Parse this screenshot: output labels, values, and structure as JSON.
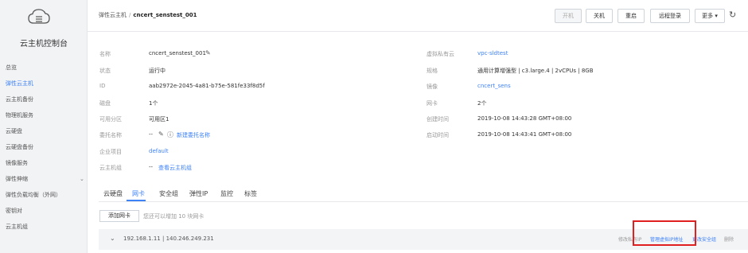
{
  "sidebar": {
    "title": "云主机控制台",
    "items": [
      {
        "label": "总览"
      },
      {
        "label": "弹性云主机"
      },
      {
        "label": "云主机备份"
      },
      {
        "label": "物理机服务"
      },
      {
        "label": "云硬盘"
      },
      {
        "label": "云硬盘备份"
      },
      {
        "label": "镜像服务"
      },
      {
        "label": "弹性伸缩"
      },
      {
        "label": "弹性负载均衡（外网）"
      },
      {
        "label": "密钥对"
      },
      {
        "label": "云主机组"
      }
    ],
    "active_index": 1
  },
  "header": {
    "breadcrumb_parent": "弹性云主机",
    "breadcrumb_sep": "/",
    "breadcrumb_current": "cncert_senstest_001",
    "buttons": {
      "start": "开机",
      "shutdown": "关机",
      "restart": "重启",
      "remote_login": "远程登录",
      "more": "更多 ▾"
    }
  },
  "info": {
    "left": {
      "name_label": "名称",
      "name_value": "cncert_senstest_001",
      "status_label": "状态",
      "status_value": "运行中",
      "id_label": "ID",
      "id_value": "aab2972e-2045-4a81-b75e-581fe33f8d5f",
      "disk_label": "磁盘",
      "disk_value": "1个",
      "az_label": "可用分区",
      "az_value": "可用区1",
      "delegate_label": "委托名称",
      "delegate_value": "--",
      "delegate_link": "新建委托名称",
      "project_label": "企业项目",
      "project_value": "default",
      "group_label": "云主机组",
      "group_value": "--",
      "group_link": "查看云主机组"
    },
    "right": {
      "vpc_label": "虚拟私有云",
      "vpc_value": "vpc-sldtest",
      "spec_label": "规格",
      "spec_value": "通用计算增强型 | c3.large.4 | 2vCPUs | 8GB",
      "image_label": "镜像",
      "image_value": "cncert_sens",
      "nic_label": "网卡",
      "nic_value": "2个",
      "created_label": "创建时间",
      "created_value": "2019-10-08 14:43:28 GMT+08:00",
      "started_label": "启动时间",
      "started_value": "2019-10-08 14:43:41 GMT+08:00"
    }
  },
  "tabs": [
    {
      "label": "云硬盘"
    },
    {
      "label": "网卡"
    },
    {
      "label": "安全组"
    },
    {
      "label": "弹性IP"
    },
    {
      "label": "监控"
    },
    {
      "label": "标签"
    }
  ],
  "active_tab": 1,
  "nic_panel": {
    "add_button": "添加网卡",
    "hint": "您还可以增加 10 块网卡",
    "row_ip": "192.168.1.11 | 140.246.249.231",
    "actions": {
      "modify_private_ip": "修改私有IP",
      "manage_virtual_ip": "管理虚拟IP地址",
      "change_security_group": "更改安全组",
      "delete": "删除"
    }
  },
  "colors": {
    "accent": "#3e82f7",
    "highlight_box": "#e02020"
  }
}
